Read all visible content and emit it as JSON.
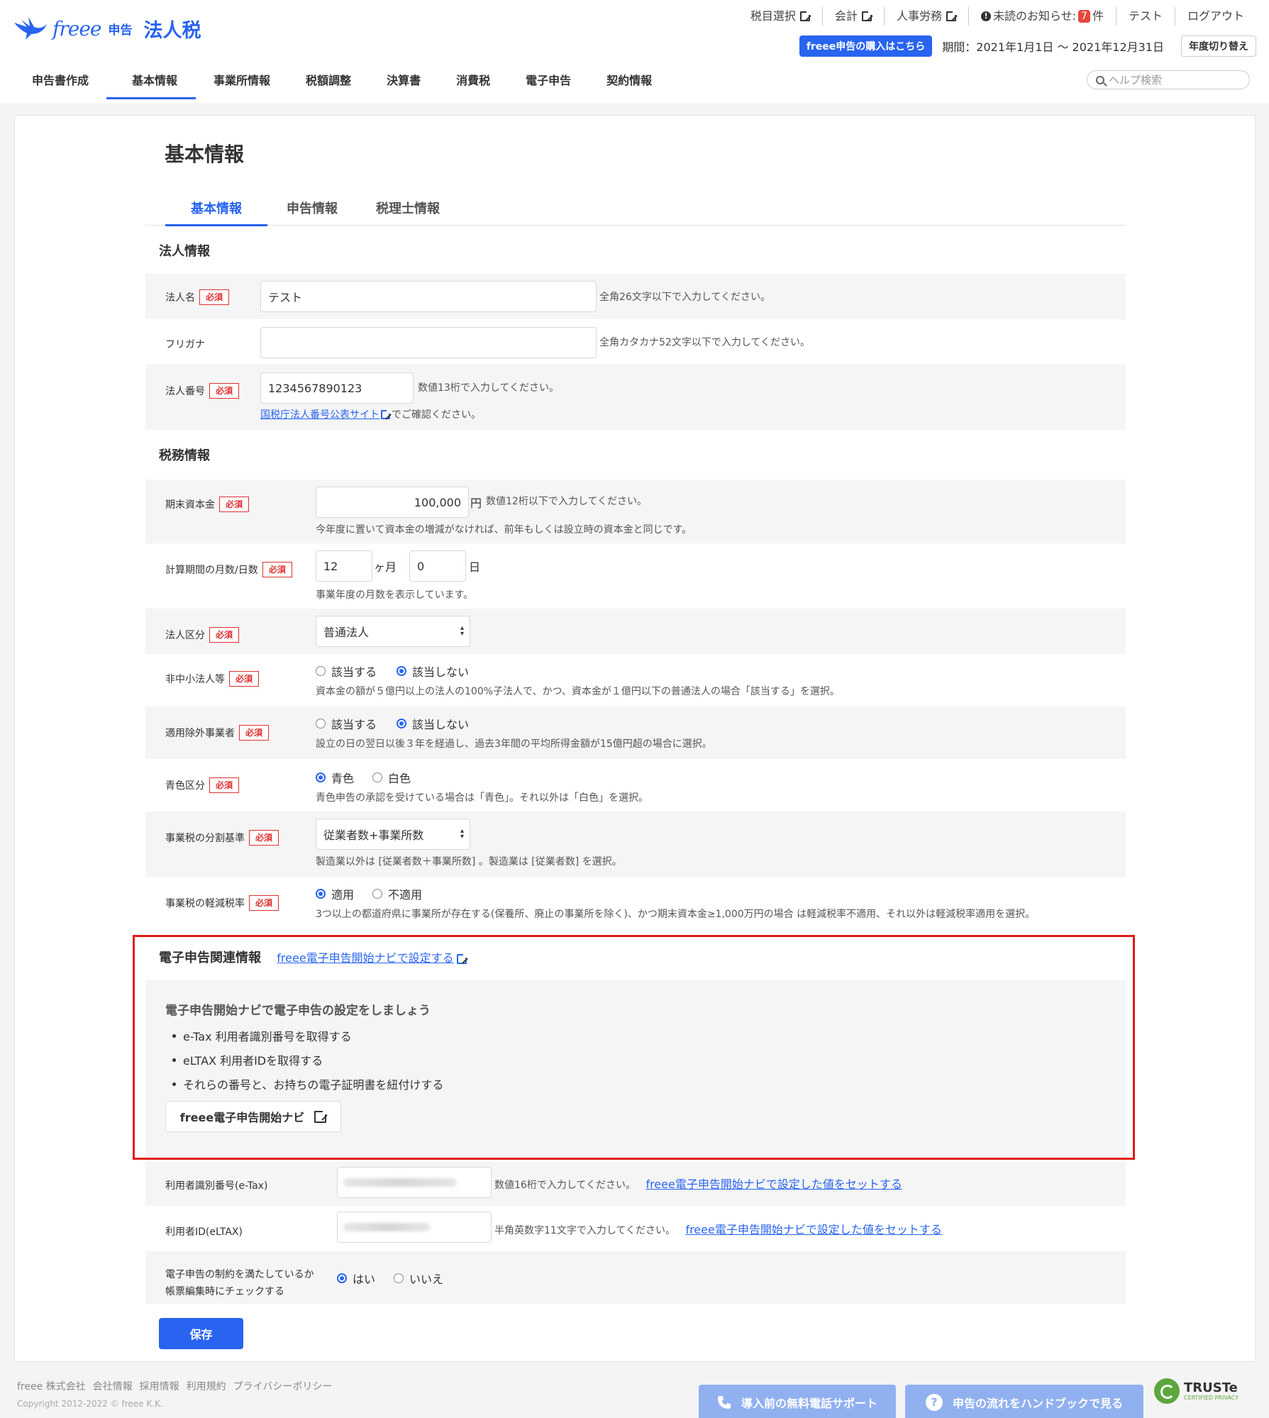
{
  "header": {
    "logo_freee": "freee",
    "logo_sub": "申告",
    "logo_main": "法人税",
    "top_links": [
      "税目選択",
      "会計",
      "人事労務"
    ],
    "notice_label": "未読のお知らせ:",
    "notice_count": "7",
    "notice_unit": "件",
    "user": "テスト",
    "logout": "ログアウト",
    "buy_label": "freee申告の購入はこちら",
    "period": "期間：2021年1月1日 ～ 2021年12月31日",
    "year_switch": "年度切り替え",
    "help_placeholder": "ヘルプ検索"
  },
  "nav": [
    "申告書作成",
    "基本情報",
    "事業所情報",
    "税額調整",
    "決算書",
    "消費税",
    "電子申告",
    "契約情報"
  ],
  "page_title": "基本情報",
  "tabs": [
    "基本情報",
    "申告情報",
    "税理士情報"
  ],
  "required": "必須",
  "corp": {
    "heading": "法人情報",
    "name_label": "法人名",
    "name_value": "テスト",
    "name_hint": "全角26文字以下で入力してください。",
    "kana_label": "フリガナ",
    "kana_value": "",
    "kana_hint": "全角カタカナ52文字以下で入力してください。",
    "number_label": "法人番号",
    "number_value": "1234567890123",
    "number_hint": "数値13桁で入力してください。",
    "number_link": "国税庁法人番号公表サイト",
    "number_link_after": "でご確認ください。"
  },
  "tax": {
    "heading": "税務情報",
    "capital_label": "期末資本金",
    "capital_value": "100,000",
    "capital_unit": "円",
    "capital_hint": "数値12桁以下で入力してください。",
    "capital_note": "今年度に置いて資本金の増減がなければ、前年もしくは設立時の資本金と同じです。",
    "period_label": "計算期間の月数/日数",
    "months_value": "12",
    "months_unit": "ヶ月",
    "days_value": "0",
    "days_unit": "日",
    "period_note": "事業年度の月数を表示しています。",
    "kubun_label": "法人区分",
    "kubun_value": "普通法人",
    "nonsme_label": "非中小法人等",
    "nonsme_opt1": "該当する",
    "nonsme_opt2": "該当しない",
    "nonsme_note": "資本金の額が５億円以上の法人の100%子法人で、かつ、資本金が１億円以下の普通法人の場合「該当する」を選択。",
    "excl_label": "適用除外事業者",
    "excl_opt1": "該当する",
    "excl_opt2": "該当しない",
    "excl_note": "設立の日の翌日以後３年を経過し、過去3年間の平均所得金額が15億円超の場合に選択。",
    "blue_label": "青色区分",
    "blue_opt1": "青色",
    "blue_opt2": "白色",
    "blue_note": "青色申告の承認を受けている場合は「青色」。それ以外は「白色」を選択。",
    "split_label": "事業税の分割基準",
    "split_value": "従業者数+事業所数",
    "split_note": "製造業以外は [従業者数＋事業所数] 。製造業は [従業者数] を選択。",
    "reduced_label": "事業税の軽減税率",
    "reduced_opt1": "適用",
    "reduced_opt2": "不適用",
    "reduced_note": "3つ以上の都道府県に事業所が存在する(保養所、廃止の事業所を除く)、かつ期末資本金≥1,000万円の場合 は軽減税率不適用、それ以外は軽減税率適用を選択。"
  },
  "efile": {
    "heading": "電子申告関連情報",
    "heading_link": "freee電子申告開始ナビで設定する",
    "navi_title": "電子申告開始ナビで電子申告の設定をしましょう",
    "bullets": [
      "e-Tax 利用者識別番号を取得する",
      "eLTAX 利用者IDを取得する",
      "それらの番号と、お持ちの電子証明書を紐付けする"
    ],
    "navi_button": "freee電子申告開始ナビ",
    "etax_label": "利用者識別番号(e-Tax)",
    "etax_hint": "数値16桁で入力してください。",
    "etax_link": "freee電子申告開始ナビで設定した値をセットする",
    "eltax_label": "利用者ID(eLTAX)",
    "eltax_hint": "半角英数字11文字で入力してください。",
    "eltax_link": "freee電子申告開始ナビで設定した値をセットする",
    "constraint_label1": "電子申告の制約を満たしているか",
    "constraint_label2": "帳票編集時にチェックする",
    "constraint_opt1": "はい",
    "constraint_opt2": "いいえ"
  },
  "save": "保存",
  "footer": {
    "links": [
      "freee 株式会社",
      "会社情報",
      "採用情報",
      "利用規約",
      "プライバシーポリシー"
    ],
    "copyright": "Copyright 2012-2022 © freee K.K.",
    "phone_btn": "導入前の無料電話サポート",
    "handbook_btn": "申告の流れをハンドブックで見る",
    "truste": "TRUSTe",
    "truste_sub": "CERTIFIED PRIVACY"
  },
  "colors": {
    "accent": "#2864f0",
    "required": "#e03030",
    "highlight": "#e01919"
  }
}
